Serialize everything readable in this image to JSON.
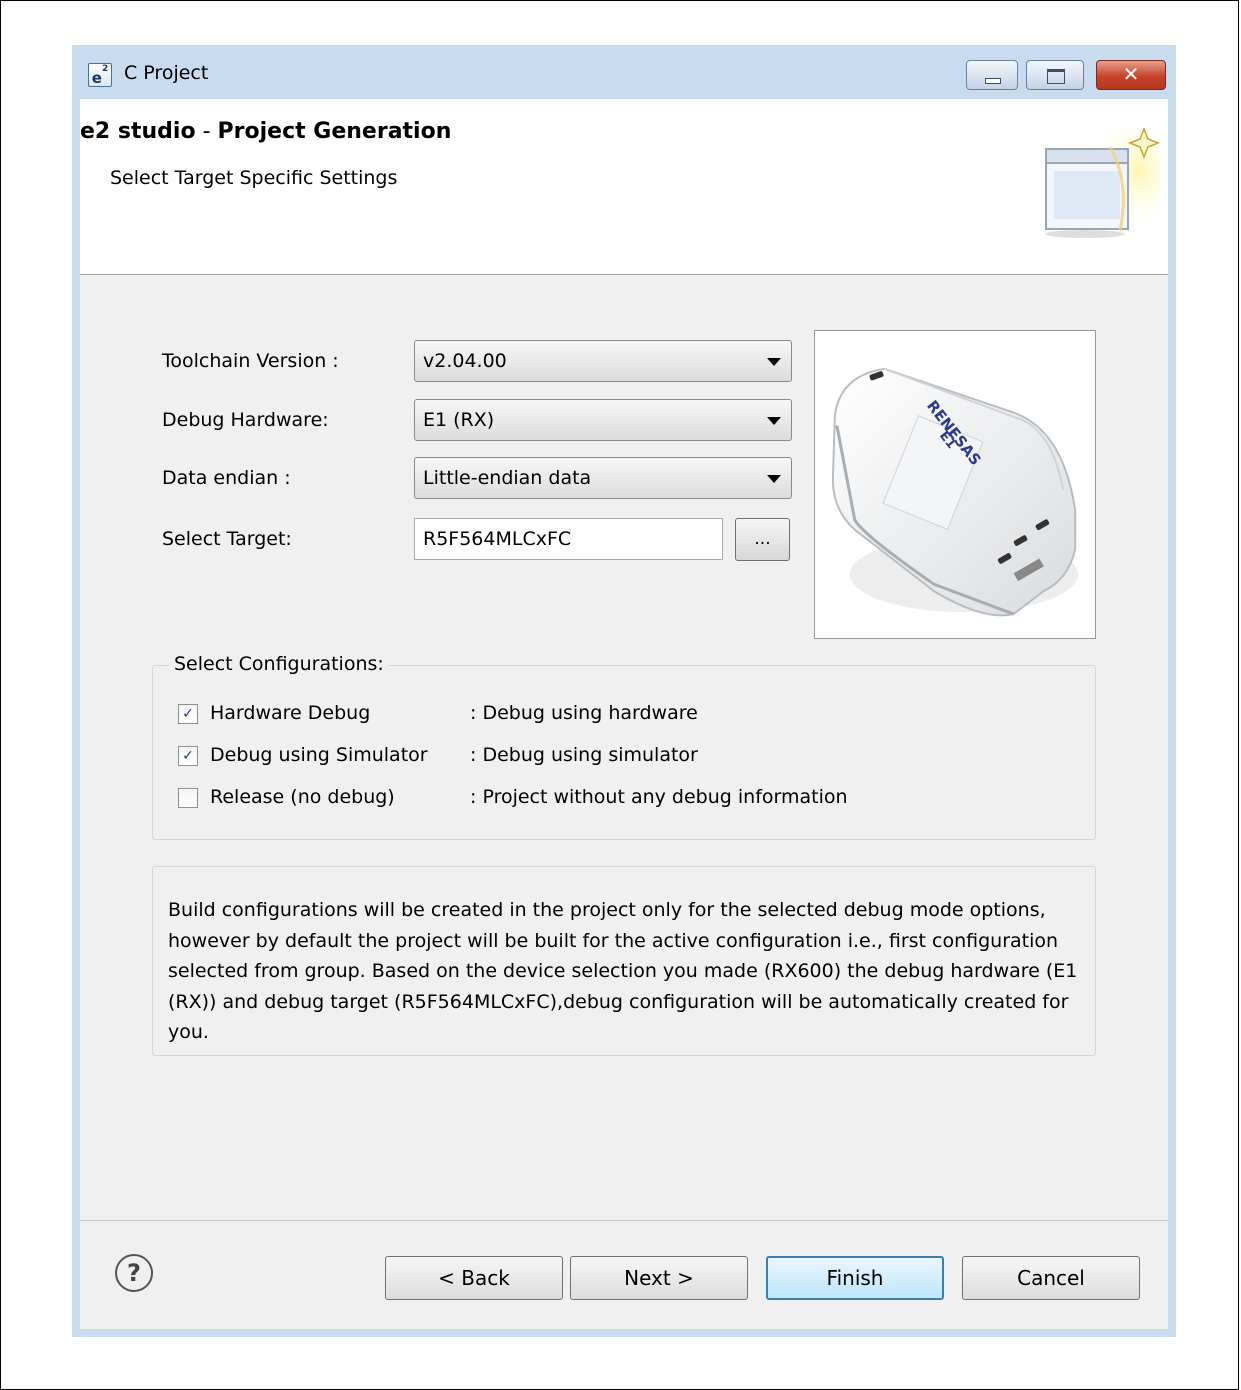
{
  "window": {
    "title": "C Project",
    "app_icon_text": "e",
    "app_icon_sup": "2"
  },
  "header": {
    "title_prefix": "e2 studio",
    "title_separator": " - ",
    "title_main": "Project Generation",
    "subtitle": "Select Target Specific Settings"
  },
  "form": {
    "toolchain_label": "Toolchain Version :",
    "toolchain_value": "v2.04.00",
    "debug_hw_label": "Debug Hardware:",
    "debug_hw_value": "E1 (RX)",
    "endian_label": "Data endian :",
    "endian_value": "Little-endian data",
    "target_label": "Select Target:",
    "target_value": "R5F564MLCxFC",
    "browse_label": "..."
  },
  "device_image": {
    "brand": "RENESAS",
    "model": "E1"
  },
  "configurations": {
    "title": "Select Configurations:",
    "items": [
      {
        "label": "Hardware Debug",
        "desc": ": Debug using hardware",
        "checked": true
      },
      {
        "label": "Debug using Simulator",
        "desc": ": Debug using simulator",
        "checked": true
      },
      {
        "label": "Release (no debug)",
        "desc": ": Project without any debug information",
        "checked": false
      }
    ]
  },
  "info": {
    "text": "Build configurations will be created in the project only for the selected debug mode options, however by default the project will be built for the active configuration i.e., first configuration selected from group. Based on the device selection you made (RX600) the debug hardware (E1 (RX)) and debug target (R5F564MLCxFC),debug configuration will be automatically created for you."
  },
  "footer": {
    "help_glyph": "?",
    "back_label": "< Back",
    "next_label": "Next >",
    "finish_label": "Finish",
    "cancel_label": "Cancel"
  },
  "colors": {
    "window_frame": "#c9dcef",
    "content_bg": "#f0f0f0",
    "finish_border": "#3c7fb1",
    "check_mark": "#1b3f77"
  }
}
